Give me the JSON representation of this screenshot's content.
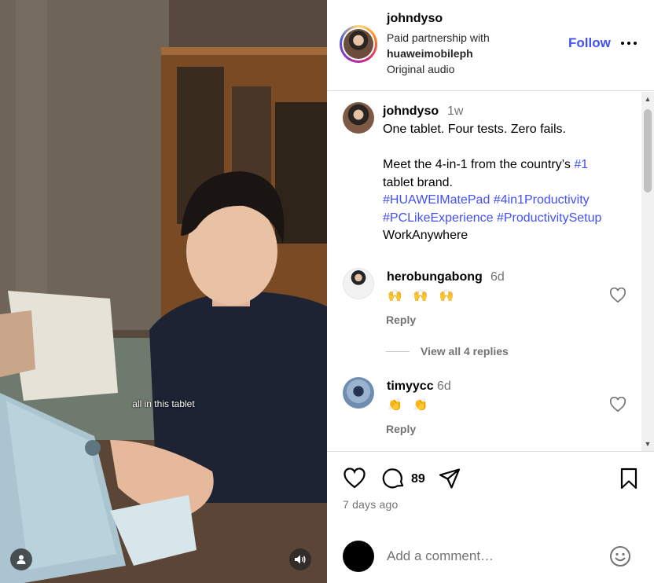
{
  "video": {
    "overlay_caption": "all in this tablet",
    "user_icon": "user-icon",
    "sound_icon": "volume-icon"
  },
  "header": {
    "username": "johndyso",
    "partnership_label": "Paid partnership with",
    "partner_name": "huaweimobileph",
    "audio_label": "Original audio",
    "follow_label": "Follow",
    "more_icon": "more-options-icon"
  },
  "caption": {
    "username": "johndyso",
    "time": "1w",
    "line1": "One tablet. Four tests. Zero fails.",
    "line2_pre": "Meet the 4-in-1 from the country’s ",
    "line2_tag": "#1",
    "line3": "tablet brand.",
    "tag_a": "#HUAWEIMatePad",
    "tag_b": "#4in1Productivity",
    "tag_c": "#PCLikeExperience",
    "tag_d": "#ProductivitySetup",
    "line_last": "WorkAnywhere"
  },
  "comments": [
    {
      "username": "herobungabong",
      "time": "6d",
      "text": "🙌 🙌 🙌",
      "reply_label": "Reply",
      "view_replies": "View all 4 replies"
    },
    {
      "username": "timyycc",
      "time": "6d",
      "text": "👏 👏",
      "reply_label": "Reply"
    }
  ],
  "actions": {
    "comment_count": "89",
    "date": "7 days ago",
    "icons": [
      "heart-icon",
      "comment-icon",
      "share-icon",
      "bookmark-icon"
    ]
  },
  "add_comment": {
    "placeholder": "Add a comment…"
  },
  "colors": {
    "link_blue": "#4150f7",
    "muted_text": "#737373",
    "divider": "#dbdbdb"
  }
}
